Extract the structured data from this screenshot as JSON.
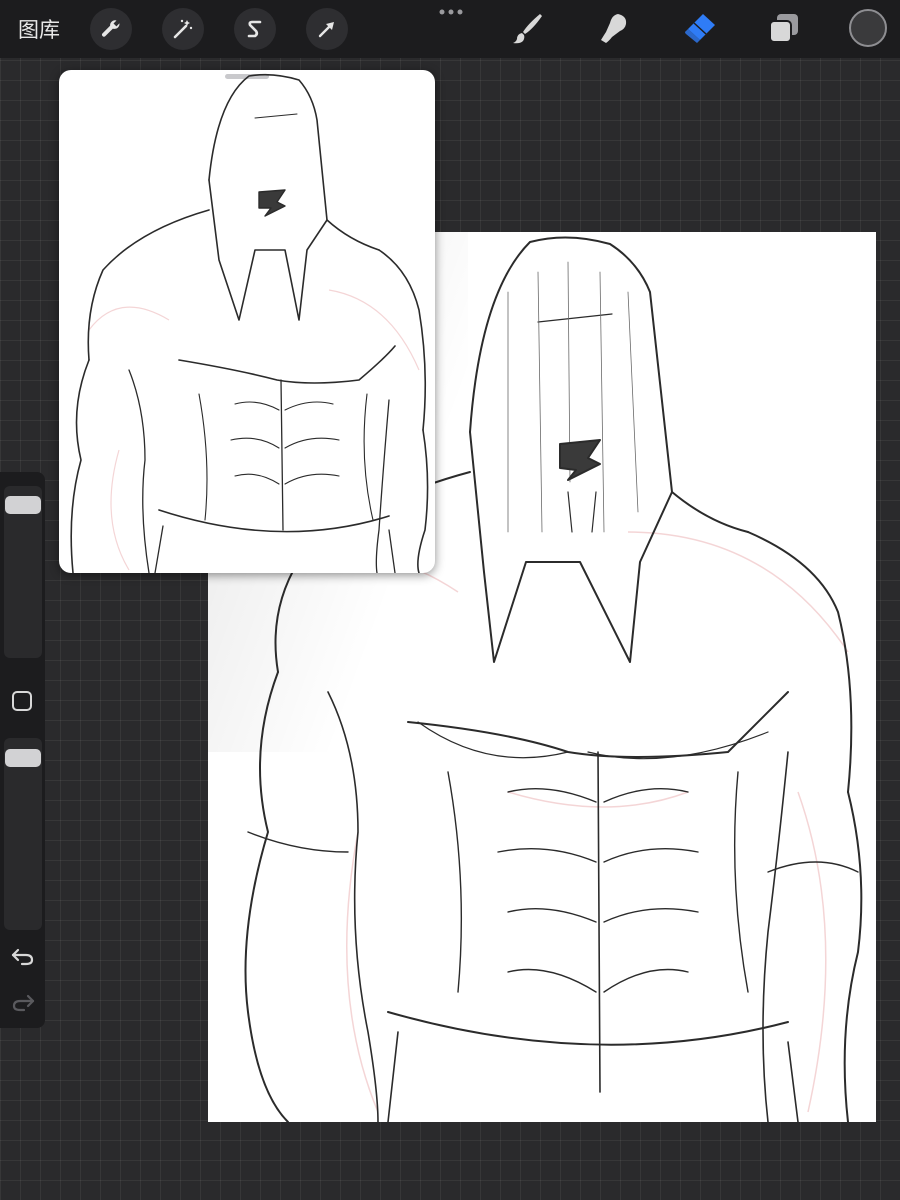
{
  "toolbar": {
    "gallery_label": "图库",
    "left_tools": [
      {
        "name": "actions",
        "icon": "wrench-icon"
      },
      {
        "name": "adjustments",
        "icon": "magic-wand-icon"
      },
      {
        "name": "selection",
        "icon": "selection-s-icon"
      },
      {
        "name": "transform",
        "icon": "arrow-cursor-icon"
      }
    ],
    "more_icon": "more-dots-icon",
    "right_tools": [
      {
        "name": "brush",
        "icon": "brush-icon",
        "active": false
      },
      {
        "name": "smudge",
        "icon": "smudge-icon",
        "active": false
      },
      {
        "name": "eraser",
        "icon": "eraser-icon",
        "active": true
      },
      {
        "name": "layers",
        "icon": "layers-icon",
        "active": false
      }
    ],
    "active_tool_color": "#2f7cf6",
    "current_color": "#3a3a3c"
  },
  "sidebar": {
    "brush_size_level": 0.95,
    "opacity_level": 0.95,
    "modify_icon": "square-outline-icon",
    "undo_icon": "undo-icon",
    "redo_icon": "redo-icon"
  },
  "canvas": {
    "background": "#ffffff",
    "artwork": "hooded-muscular-figure-sketch"
  },
  "reference": {
    "artwork": "hooded-muscular-figure-sketch-reference"
  }
}
